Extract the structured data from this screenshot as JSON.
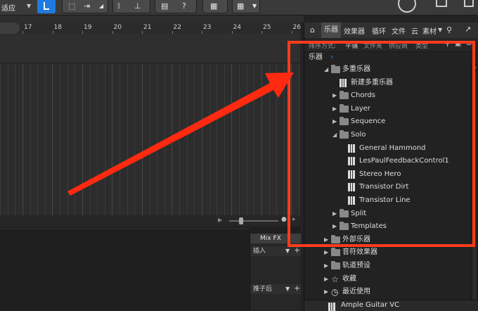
{
  "toolbar": {
    "zoom_label": "适应",
    "icons": [
      "snap-icon",
      "pointer-icon",
      "split-icon",
      "bend-icon",
      "metronome-icon",
      "help-icon",
      "video-icon",
      "grid-icon",
      "user-icon",
      "window-icon"
    ]
  },
  "ruler": {
    "bars": [
      "17",
      "18",
      "19",
      "20",
      "21",
      "22",
      "23",
      "24",
      "25",
      "26"
    ]
  },
  "mixfx": {
    "header": "Mix FX",
    "insert_label": "插入",
    "send_label": "推子后"
  },
  "browser": {
    "tabs": [
      "乐器",
      "效果器",
      "循环",
      "文件",
      "云",
      "素材"
    ],
    "subbar": [
      "排序方式:",
      "平铺",
      "文件夹",
      "供应商",
      "类型"
    ],
    "breadcrumb": "乐器",
    "tree": [
      {
        "label": "多重乐器",
        "type": "folder",
        "expanded": true,
        "level": 0
      },
      {
        "label": "新建多重乐器",
        "type": "instrument",
        "level": 1
      },
      {
        "label": "Chords",
        "type": "folder",
        "expanded": false,
        "level": 1
      },
      {
        "label": "Layer",
        "type": "folder",
        "expanded": false,
        "level": 1
      },
      {
        "label": "Sequence",
        "type": "folder",
        "expanded": false,
        "level": 1
      },
      {
        "label": "Solo",
        "type": "folder",
        "expanded": true,
        "level": 1
      },
      {
        "label": "General Hammond",
        "type": "instrument",
        "level": 2
      },
      {
        "label": "LesPaulFeedbackControl1",
        "type": "instrument",
        "level": 2
      },
      {
        "label": "Stereo Hero",
        "type": "instrument",
        "level": 2
      },
      {
        "label": "Transistor Dirt",
        "type": "instrument",
        "level": 2
      },
      {
        "label": "Transistor Line",
        "type": "instrument",
        "level": 2
      },
      {
        "label": "Split",
        "type": "folder",
        "expanded": false,
        "level": 1
      },
      {
        "label": "Templates",
        "type": "folder",
        "expanded": false,
        "level": 1
      },
      {
        "label": "外部乐器",
        "type": "folder",
        "expanded": false,
        "level": 0
      },
      {
        "label": "音符效果器",
        "type": "folder",
        "expanded": false,
        "level": 0
      },
      {
        "label": "轨道预设",
        "type": "folder",
        "expanded": false,
        "level": 0
      },
      {
        "label": "收藏",
        "type": "star",
        "expanded": false,
        "level": 0
      },
      {
        "label": "最近使用",
        "type": "clock",
        "expanded": false,
        "level": 0
      }
    ],
    "bottom_item": "Ample Guitar VC"
  },
  "colors": {
    "highlight": "#ff3b1c",
    "accent": "#1e7be0",
    "panel": "#222222"
  }
}
